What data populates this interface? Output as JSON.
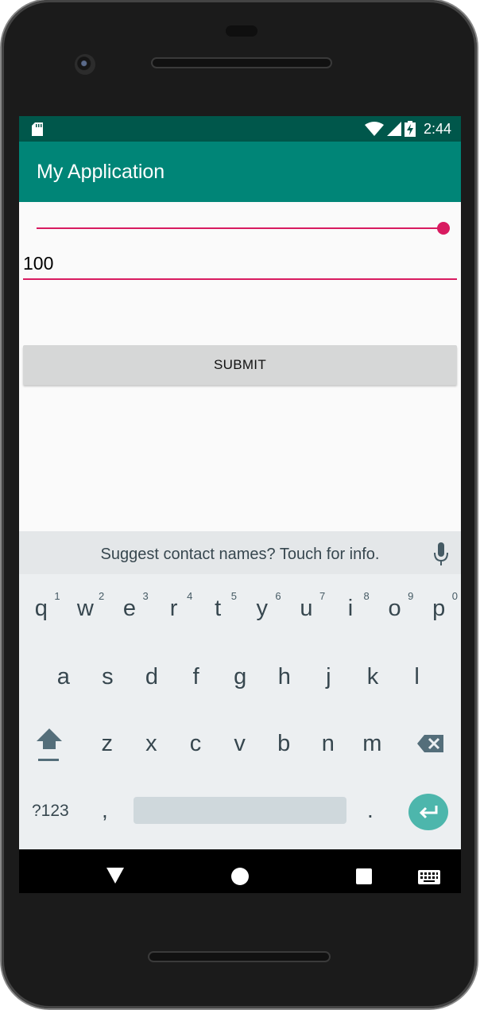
{
  "status_bar": {
    "time": "2:44"
  },
  "app_bar": {
    "title": "My Application"
  },
  "form": {
    "slider_value": 100,
    "input_value": "100",
    "submit_label": "SUBMIT"
  },
  "keyboard": {
    "suggestion": "Suggest contact names? Touch for info.",
    "row1": [
      {
        "key": "q",
        "hint": "1"
      },
      {
        "key": "w",
        "hint": "2"
      },
      {
        "key": "e",
        "hint": "3"
      },
      {
        "key": "r",
        "hint": "4"
      },
      {
        "key": "t",
        "hint": "5"
      },
      {
        "key": "y",
        "hint": "6"
      },
      {
        "key": "u",
        "hint": "7"
      },
      {
        "key": "i",
        "hint": "8"
      },
      {
        "key": "o",
        "hint": "9"
      },
      {
        "key": "p",
        "hint": "0"
      }
    ],
    "row2": [
      "a",
      "s",
      "d",
      "f",
      "g",
      "h",
      "j",
      "k",
      "l"
    ],
    "row3": [
      "z",
      "x",
      "c",
      "v",
      "b",
      "n",
      "m"
    ],
    "symbols_label": "?123",
    "comma_label": ",",
    "period_label": "."
  },
  "colors": {
    "status_bar": "#00574b",
    "app_bar": "#008577",
    "accent": "#d81b60",
    "enter_key": "#4db6ac"
  }
}
